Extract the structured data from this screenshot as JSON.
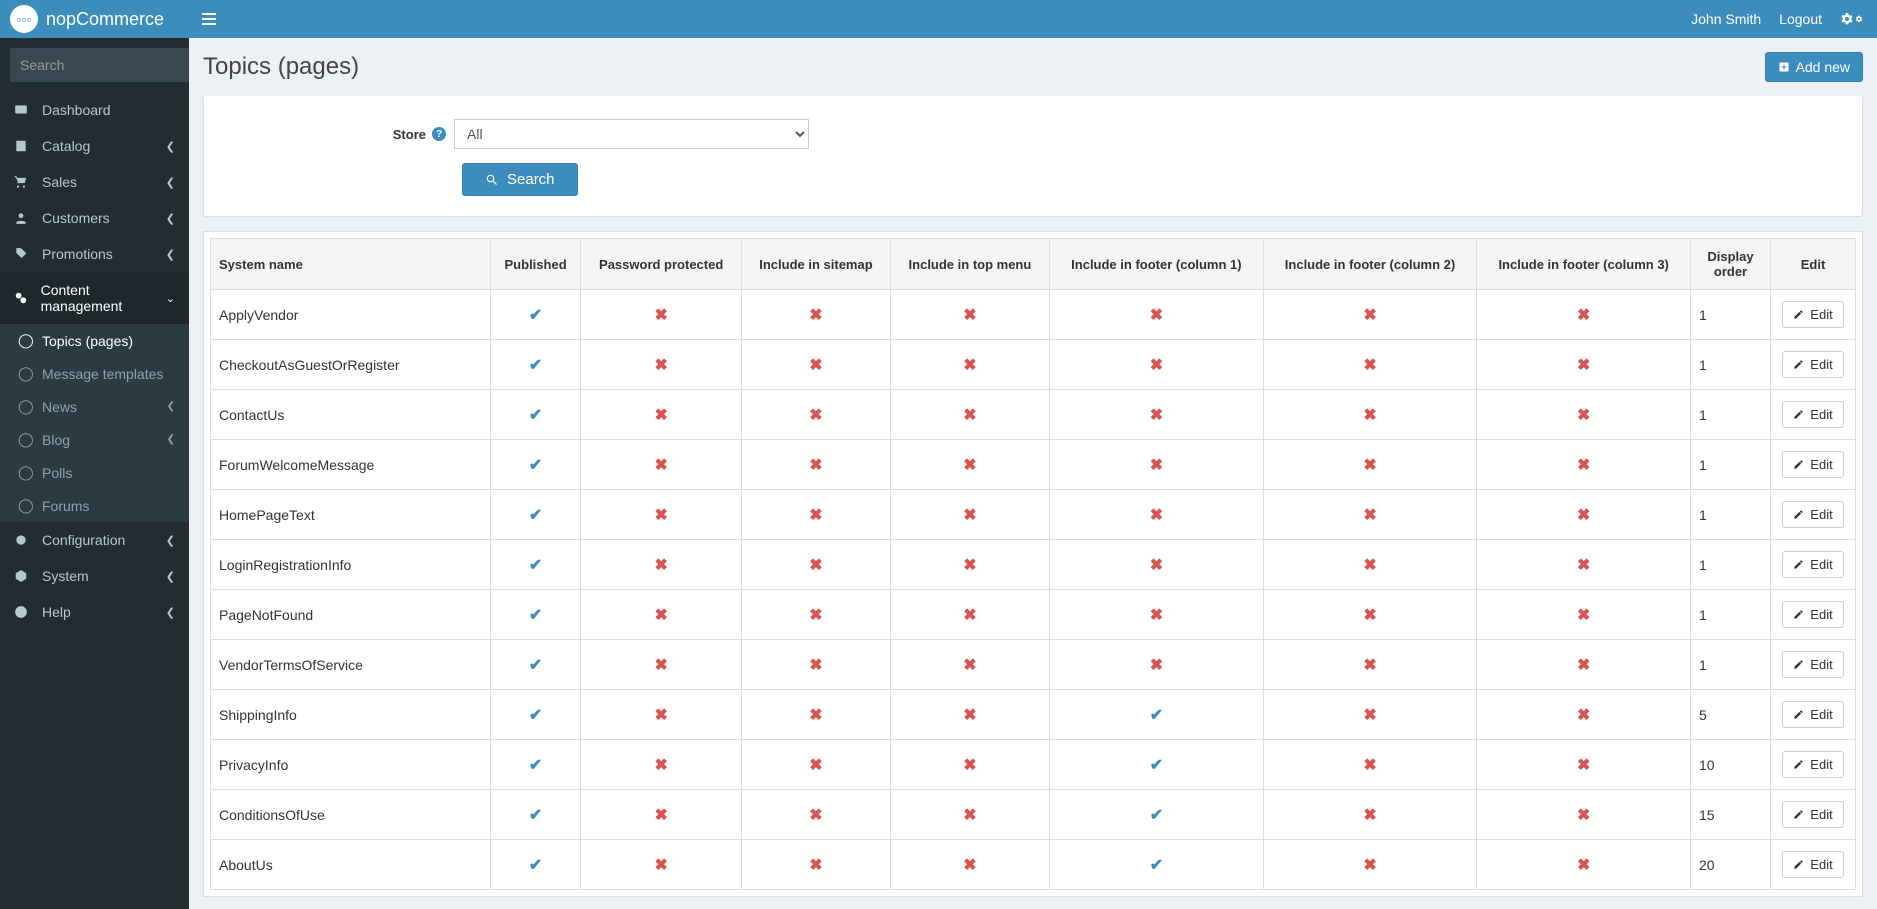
{
  "header": {
    "brand_prefix": "nop",
    "brand_suffix": "Commerce",
    "user": "John Smith",
    "logout": "Logout"
  },
  "search": {
    "placeholder": "Search"
  },
  "nav": {
    "dashboard": "Dashboard",
    "catalog": "Catalog",
    "sales": "Sales",
    "customers": "Customers",
    "promotions": "Promotions",
    "content": "Content management",
    "configuration": "Configuration",
    "system": "System",
    "help": "Help"
  },
  "content_sub": {
    "topics": "Topics (pages)",
    "message_templates": "Message templates",
    "news": "News",
    "blog": "Blog",
    "polls": "Polls",
    "forums": "Forums"
  },
  "page": {
    "title": "Topics (pages)",
    "add_new": "Add new",
    "store_label": "Store",
    "store_selected": "All",
    "search_button": "Search"
  },
  "table": {
    "headers": {
      "system_name": "System name",
      "published": "Published",
      "password": "Password protected",
      "sitemap": "Include in sitemap",
      "topmenu": "Include in top menu",
      "footer1": "Include in footer (column 1)",
      "footer2": "Include in footer (column 2)",
      "footer3": "Include in footer (column 3)",
      "display_order": "Display order",
      "edit": "Edit"
    },
    "edit_label": "Edit",
    "rows": [
      {
        "name": "ApplyVendor",
        "published": true,
        "password": false,
        "sitemap": false,
        "topmenu": false,
        "f1": false,
        "f2": false,
        "f3": false,
        "order": "1"
      },
      {
        "name": "CheckoutAsGuestOrRegister",
        "published": true,
        "password": false,
        "sitemap": false,
        "topmenu": false,
        "f1": false,
        "f2": false,
        "f3": false,
        "order": "1"
      },
      {
        "name": "ContactUs",
        "published": true,
        "password": false,
        "sitemap": false,
        "topmenu": false,
        "f1": false,
        "f2": false,
        "f3": false,
        "order": "1"
      },
      {
        "name": "ForumWelcomeMessage",
        "published": true,
        "password": false,
        "sitemap": false,
        "topmenu": false,
        "f1": false,
        "f2": false,
        "f3": false,
        "order": "1"
      },
      {
        "name": "HomePageText",
        "published": true,
        "password": false,
        "sitemap": false,
        "topmenu": false,
        "f1": false,
        "f2": false,
        "f3": false,
        "order": "1"
      },
      {
        "name": "LoginRegistrationInfo",
        "published": true,
        "password": false,
        "sitemap": false,
        "topmenu": false,
        "f1": false,
        "f2": false,
        "f3": false,
        "order": "1"
      },
      {
        "name": "PageNotFound",
        "published": true,
        "password": false,
        "sitemap": false,
        "topmenu": false,
        "f1": false,
        "f2": false,
        "f3": false,
        "order": "1"
      },
      {
        "name": "VendorTermsOfService",
        "published": true,
        "password": false,
        "sitemap": false,
        "topmenu": false,
        "f1": false,
        "f2": false,
        "f3": false,
        "order": "1"
      },
      {
        "name": "ShippingInfo",
        "published": true,
        "password": false,
        "sitemap": false,
        "topmenu": false,
        "f1": true,
        "f2": false,
        "f3": false,
        "order": "5"
      },
      {
        "name": "PrivacyInfo",
        "published": true,
        "password": false,
        "sitemap": false,
        "topmenu": false,
        "f1": true,
        "f2": false,
        "f3": false,
        "order": "10"
      },
      {
        "name": "ConditionsOfUse",
        "published": true,
        "password": false,
        "sitemap": false,
        "topmenu": false,
        "f1": true,
        "f2": false,
        "f3": false,
        "order": "15"
      },
      {
        "name": "AboutUs",
        "published": true,
        "password": false,
        "sitemap": false,
        "topmenu": false,
        "f1": true,
        "f2": false,
        "f3": false,
        "order": "20"
      }
    ]
  }
}
